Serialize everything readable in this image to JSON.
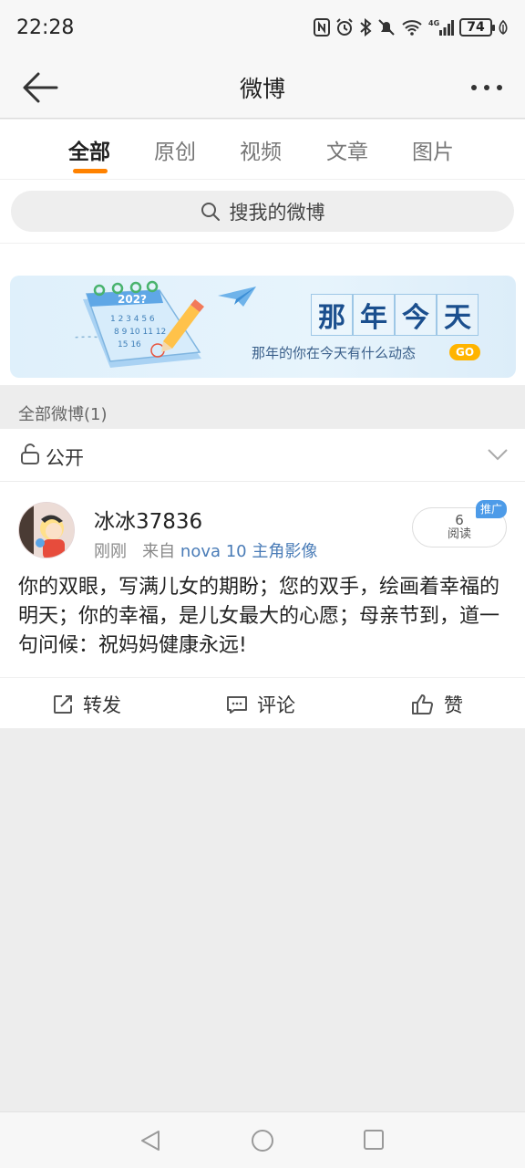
{
  "status_bar": {
    "time": "22:28",
    "battery": "74",
    "network": "4G"
  },
  "header": {
    "title": "微博",
    "back_icon": "back-arrow-icon",
    "more_icon": "more-dots-icon"
  },
  "tabs": [
    {
      "label": "全部",
      "active": true
    },
    {
      "label": "原创",
      "active": false
    },
    {
      "label": "视频",
      "active": false
    },
    {
      "label": "文章",
      "active": false
    },
    {
      "label": "图片",
      "active": false
    }
  ],
  "search": {
    "label": "搜我的微博"
  },
  "banner": {
    "calendar_year": "202?",
    "title_chars": [
      "那",
      "年",
      "今",
      "天"
    ],
    "subtitle": "那年的你在今天有什么动态",
    "go_label": "GO"
  },
  "section": {
    "label": "全部微博(1)"
  },
  "privacy": {
    "label": "公开"
  },
  "post": {
    "username": "冰冰37836",
    "time": "刚刚",
    "source_prefix": "来自",
    "source": "nova 10 主角影像",
    "read_count": "6",
    "read_label": "阅读",
    "promo_label": "推广",
    "content": "你的双眼，写满儿女的期盼；您的双手，绘画着幸福的明天；你的幸福，是儿女最大的心愿；母亲节到，道一句问候：祝妈妈健康永远!",
    "actions": {
      "repost": "转发",
      "comment": "评论",
      "like": "赞"
    }
  },
  "colors": {
    "accent": "#ff8200",
    "link": "#4a7cb7",
    "promo": "#4d9be8",
    "go": "#ffb400"
  }
}
